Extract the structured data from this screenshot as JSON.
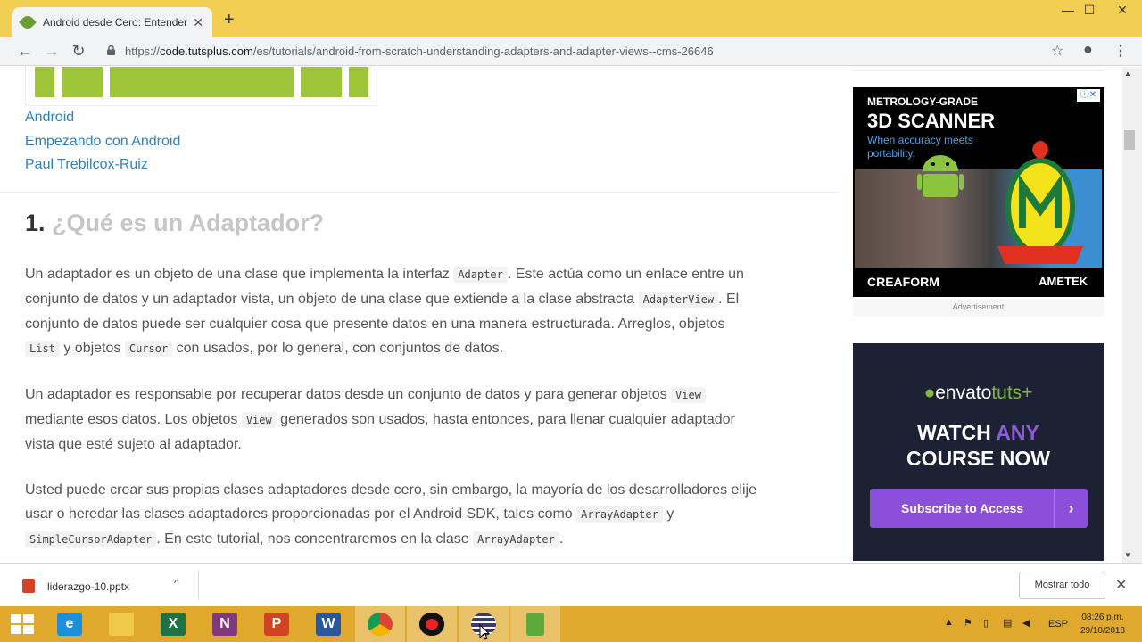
{
  "browser": {
    "tab_title": "Android desde Cero: Entender A",
    "tab_close": "✕",
    "new_tab": "+",
    "window_controls": {
      "minimize": "—",
      "maximize": "☐",
      "close": "✕"
    },
    "nav": {
      "back": "←",
      "forward": "→",
      "reload": "↻"
    },
    "url_prefix": "https://",
    "url_domain": "code.tutsplus.com",
    "url_path": "/es/tutorials/android-from-scratch-understanding-adapters-and-adapter-views--cms-26646",
    "star": "☆",
    "account": "●",
    "menu": "⋮"
  },
  "article": {
    "categories": [
      "Android",
      "Empezando con Android",
      "Paul Trebilcox-Ruiz"
    ],
    "heading_number": "1.",
    "heading_text": "¿Qué es un Adaptador?",
    "p1": {
      "t1": "Un adaptador es un objeto de una clase que implementa la interfaz ",
      "c1": "Adapter",
      "t2": ". Este actúa como un enlace entre un conjunto de datos y un adaptador vista, un objeto de una clase que extiende a la clase abstracta ",
      "c2": "AdapterView",
      "t3": ". El conjunto de datos puede ser cualquier cosa que presente datos en una manera estructurada. Arreglos, objetos ",
      "c3": "List",
      "t4": " y objetos ",
      "c4": "Cursor",
      "t5": " con usados, por lo general, con conjuntos de datos."
    },
    "p2": {
      "t1": "Un adaptador es responsable por recuperar datos desde un conjunto de datos y para generar objetos ",
      "c1": "View",
      "t2": " mediante esos datos. Los objetos ",
      "c2": "View",
      "t3": " generados son usados, hasta entonces, para llenar cualquier adaptador vista que esté sujeto al adaptador."
    },
    "p3": {
      "t1": "Usted puede crear sus propias clases adaptadores desde cero, sin embargo, la mayoría de los desarrolladores elije usar o heredar las clases adaptadores proporcionadas por el Android SDK, tales como ",
      "c1": "ArrayAdapter",
      "t2": " y ",
      "c2": "SimpleCursorAdapter",
      "t3": ". En este tutorial, nos concentraremos en la clase ",
      "c3": "ArrayAdapter",
      "t4": "."
    }
  },
  "ad1": {
    "line1": "METROLOGY-GRADE",
    "line2": "3D SCANNER",
    "line3": "When accuracy meets portability.",
    "brand_left": "CREAFORM",
    "brand_right": "AMETEK",
    "adchoices": "ⓘ✕",
    "label": "Advertisement"
  },
  "ad2": {
    "logo_envato": "envato",
    "logo_tuts": "tuts+",
    "headline_watch": "WATCH ",
    "headline_any": "ANY",
    "headline_rest": "COURSE NOW",
    "cta": "Subscribe to Access",
    "cta_chevron": "›"
  },
  "downloads": {
    "file_name": "liderazgo-10.pptx",
    "chevron": "^",
    "show_all": "Mostrar todo",
    "close": "✕"
  },
  "taskbar": {
    "apps": [
      {
        "name": "internet-explorer",
        "glyph": "e",
        "color": "#1b8fd9"
      },
      {
        "name": "file-explorer",
        "glyph": "",
        "color": "#f0c84a"
      },
      {
        "name": "excel",
        "glyph": "X",
        "color": "#1f7244"
      },
      {
        "name": "onenote",
        "glyph": "N",
        "color": "#80397b"
      },
      {
        "name": "powerpoint",
        "glyph": "P",
        "color": "#d04423"
      },
      {
        "name": "word",
        "glyph": "W",
        "color": "#2b579a"
      },
      {
        "name": "chrome",
        "glyph": "",
        "color": "#db4437"
      },
      {
        "name": "recorder",
        "glyph": "",
        "color": "#111111"
      },
      {
        "name": "app-striped",
        "glyph": "",
        "color": "#3b3b6b"
      },
      {
        "name": "app-green",
        "glyph": "",
        "color": "#5fa83b"
      }
    ],
    "language": "ESP",
    "time": "08:26 p.m.",
    "date": "29/10/2018"
  }
}
